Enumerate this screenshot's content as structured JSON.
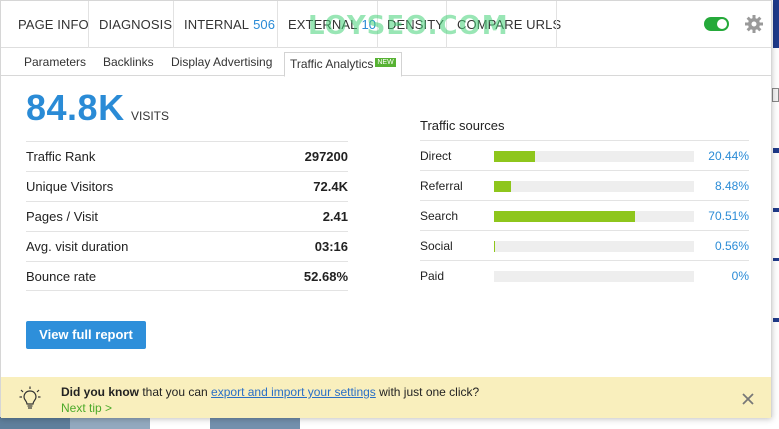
{
  "toolbar": {
    "tabs": [
      {
        "label": "PAGE INFO"
      },
      {
        "label": "DIAGNOSIS"
      },
      {
        "label": "INTERNAL",
        "count": "506"
      },
      {
        "label": "EXTERNAL",
        "count": "10"
      },
      {
        "label": "DENSITY"
      },
      {
        "label": "COMPARE URLS"
      }
    ],
    "watermark": "LOYSEO.COM",
    "toggle_state": "on",
    "colors": {
      "accent": "#2a8bd6",
      "toggle_on": "#25a93a",
      "bar_fill": "#8ec61c"
    }
  },
  "subtabs": [
    {
      "label": "Parameters"
    },
    {
      "label": "Backlinks"
    },
    {
      "label": "Display Advertising"
    },
    {
      "label": "Traffic Analytics",
      "badge": "NEW",
      "active": true
    }
  ],
  "summary": {
    "visits_value": "84.8K",
    "visits_label": "VISITS"
  },
  "stats": [
    {
      "label": "Traffic Rank",
      "value": "297200"
    },
    {
      "label": "Unique Visitors",
      "value": "72.4K"
    },
    {
      "label": "Pages / Visit",
      "value": "2.41"
    },
    {
      "label": "Avg. visit duration",
      "value": "03:16"
    },
    {
      "label": "Bounce rate",
      "value": "52.68%"
    }
  ],
  "traffic_sources": {
    "title": "Traffic sources",
    "items": [
      {
        "label": "Direct",
        "percent": "20.44%",
        "share": 20.44
      },
      {
        "label": "Referral",
        "percent": "8.48%",
        "share": 8.48
      },
      {
        "label": "Search",
        "percent": "70.51%",
        "share": 70.51
      },
      {
        "label": "Social",
        "percent": "0.56%",
        "share": 0.56
      },
      {
        "label": "Paid",
        "percent": "0%",
        "share": 0
      }
    ]
  },
  "actions": {
    "full_report": "View full report"
  },
  "tip": {
    "lead": "Did you know",
    "text_before": " that you can ",
    "link": "export and import your settings",
    "text_after": " with just one click?",
    "next": "Next tip >"
  }
}
